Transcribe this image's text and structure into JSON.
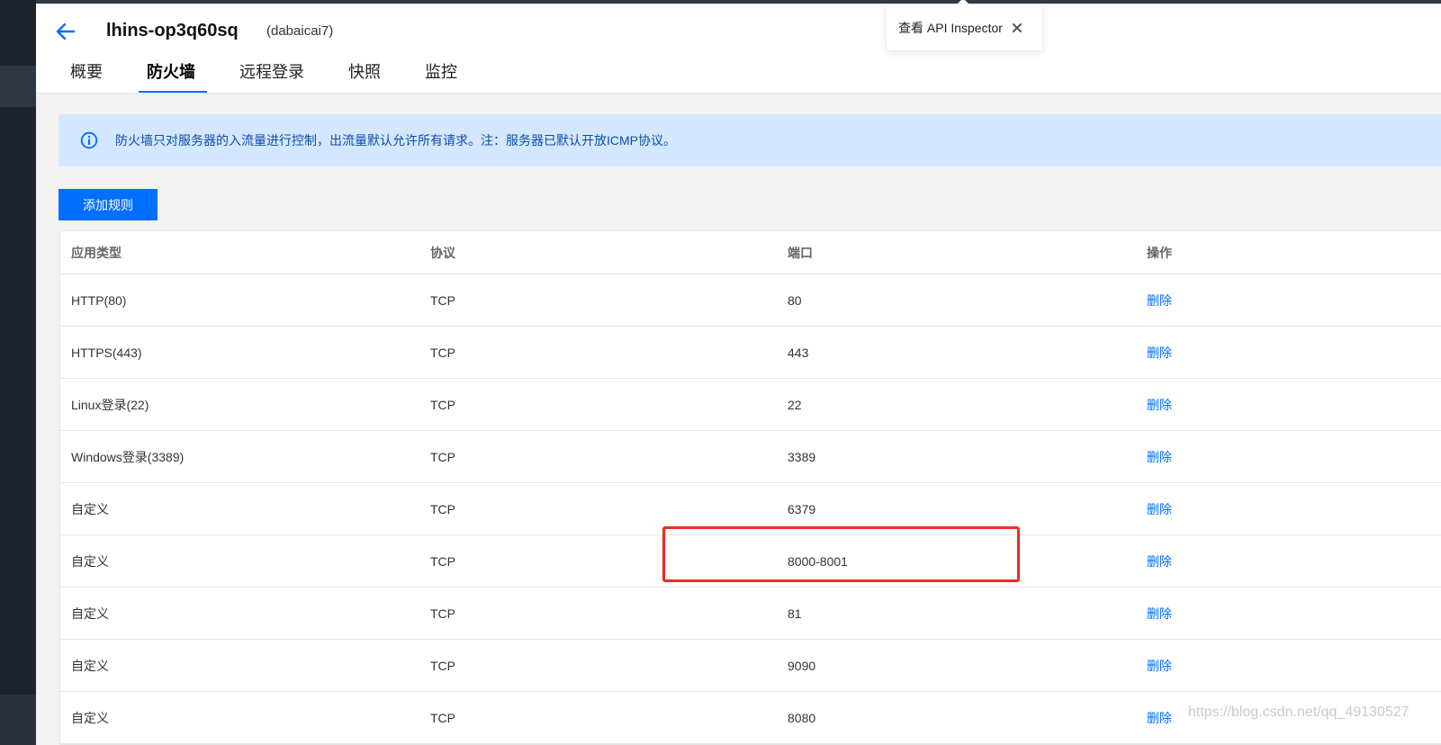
{
  "header": {
    "instance_name": "lhins-op3q60sq",
    "instance_alias": "(dabaicai7)"
  },
  "tabs": [
    {
      "label": "概要",
      "active": false
    },
    {
      "label": "防火墙",
      "active": true
    },
    {
      "label": "远程登录",
      "active": false
    },
    {
      "label": "快照",
      "active": false
    },
    {
      "label": "监控",
      "active": false
    }
  ],
  "api_popover": {
    "label": "查看 API Inspector"
  },
  "notice": {
    "text": "防火墙只对服务器的入流量进行控制，出流量默认允许所有请求。注：服务器已默认开放ICMP协议。"
  },
  "toolbar": {
    "add_rule_label": "添加规则"
  },
  "table": {
    "headers": [
      "应用类型",
      "协议",
      "端口",
      "操作"
    ],
    "rows": [
      {
        "app": "HTTP(80)",
        "protocol": "TCP",
        "port": "80",
        "action": "删除"
      },
      {
        "app": "HTTPS(443)",
        "protocol": "TCP",
        "port": "443",
        "action": "删除"
      },
      {
        "app": "Linux登录(22)",
        "protocol": "TCP",
        "port": "22",
        "action": "删除"
      },
      {
        "app": "Windows登录(3389)",
        "protocol": "TCP",
        "port": "3389",
        "action": "删除"
      },
      {
        "app": "自定义",
        "protocol": "TCP",
        "port": "6379",
        "action": "删除"
      },
      {
        "app": "自定义",
        "protocol": "TCP",
        "port": "8000-8001",
        "action": "删除"
      },
      {
        "app": "自定义",
        "protocol": "TCP",
        "port": "81",
        "action": "删除"
      },
      {
        "app": "自定义",
        "protocol": "TCP",
        "port": "9090",
        "action": "删除"
      },
      {
        "app": "自定义",
        "protocol": "TCP",
        "port": "8080",
        "action": "删除"
      }
    ]
  },
  "watermark": "https://blog.csdn.net/qq_49130527",
  "colors": {
    "accent": "#006eff",
    "highlight": "#ee2b24",
    "notice_bg": "#d5e7ff"
  }
}
